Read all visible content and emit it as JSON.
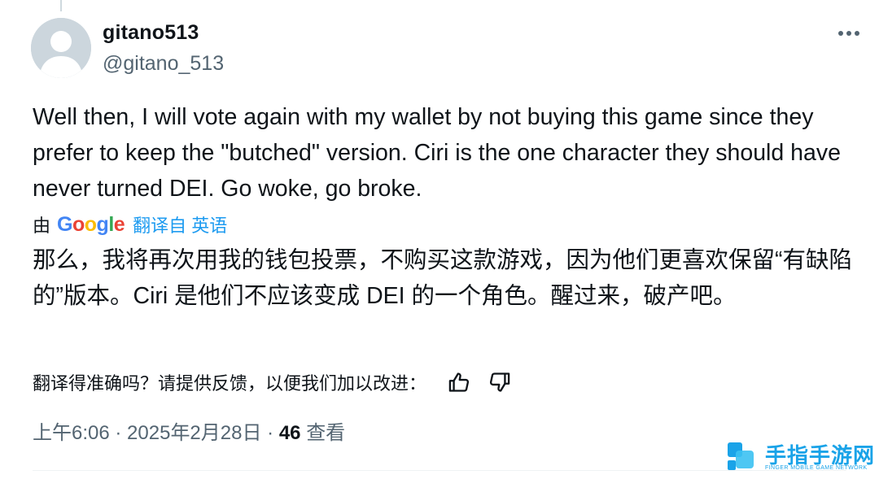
{
  "tweet": {
    "display_name": "gitano513",
    "handle": "@gitano_513",
    "text": "Well then, I will vote again with my wallet by not buying this game since they prefer to keep the \"butched\" version. Ciri is the one character they should have never turned DEI. Go woke, go broke."
  },
  "translation": {
    "by_label": "由",
    "google_letters": [
      "G",
      "o",
      "o",
      "g",
      "l",
      "e"
    ],
    "google_colors": [
      "#4285f4",
      "#ea4335",
      "#fbbc05",
      "#4285f4",
      "#34a853",
      "#ea4335"
    ],
    "link_label": "翻译自 英语",
    "text": "那么，我将再次用我的钱包投票，不购买这款游戏，因为他们更喜欢保留“有缺陷的”版本。Ciri 是他们不应该变成 DEI 的一个角色。醒过来，破产吧。"
  },
  "feedback": {
    "question": "翻译得准确吗？请提供反馈，以便我们加以改进："
  },
  "meta": {
    "time": "上午6:06",
    "separator": " · ",
    "date": "2025年2月28日",
    "views_count": "46",
    "views_label": "查看"
  },
  "watermark": {
    "title": "手指手游网",
    "subtitle": "FINGER MOBILE GAME NETWORK"
  },
  "icons": {
    "more": "more-horizontal-icon",
    "thumbs_up": "thumbs-up-icon",
    "thumbs_down": "thumbs-down-icon"
  },
  "colors": {
    "link": "#1d9bf0",
    "secondary_text": "#536471",
    "primary_text": "#0f1419",
    "avatar_bg": "#ccd6dd"
  }
}
